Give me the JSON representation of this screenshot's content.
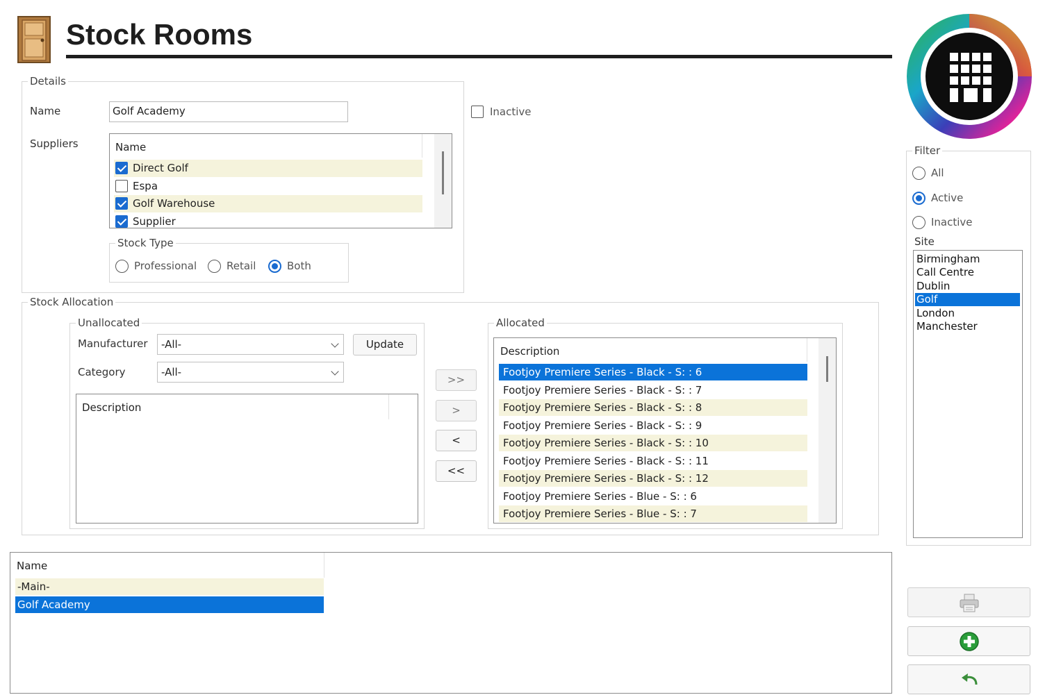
{
  "page": {
    "title": "Stock Rooms"
  },
  "details": {
    "legend": "Details",
    "name_label": "Name",
    "name_value": "Golf Academy",
    "inactive_label": "Inactive",
    "inactive_checked": false,
    "suppliers_label": "Suppliers",
    "suppliers_header": "Name",
    "suppliers": [
      {
        "name": "Direct Golf",
        "checked": true
      },
      {
        "name": "Espa",
        "checked": false
      },
      {
        "name": "Golf Warehouse",
        "checked": true
      },
      {
        "name": "Supplier",
        "checked": true
      }
    ],
    "stock_type": {
      "legend": "Stock Type",
      "options": [
        "Professional",
        "Retail",
        "Both"
      ],
      "selected": "Both"
    }
  },
  "allocation": {
    "legend": "Stock Allocation",
    "unallocated": {
      "legend": "Unallocated",
      "manufacturer_label": "Manufacturer",
      "manufacturer_value": "-All-",
      "category_label": "Category",
      "category_value": "-All-",
      "update_label": "Update",
      "list_header": "Description"
    },
    "move_buttons": [
      ">>",
      ">",
      "<",
      "<<"
    ],
    "allocated": {
      "legend": "Allocated",
      "list_header": "Description",
      "items": [
        "Footjoy Premiere Series - Black - S: : 6",
        "Footjoy Premiere Series - Black - S: : 7",
        "Footjoy Premiere Series - Black - S: : 8",
        "Footjoy Premiere Series - Black - S: : 9",
        "Footjoy Premiere Series - Black - S: : 10",
        "Footjoy Premiere Series - Black - S: : 11",
        "Footjoy Premiere Series - Black - S: : 12",
        "Footjoy Premiere Series - Blue - S: : 6",
        "Footjoy Premiere Series - Blue - S: : 7"
      ],
      "selected_index": 0
    }
  },
  "rooms": {
    "header": "Name",
    "items": [
      "-Main-",
      "Golf Academy"
    ],
    "selected_index": 1
  },
  "filter": {
    "legend": "Filter",
    "options": [
      "All",
      "Active",
      "Inactive"
    ],
    "selected": "Active",
    "site_label": "Site",
    "sites": [
      "Birmingham",
      "Call Centre",
      "Dublin",
      "Golf",
      "London",
      "Manchester"
    ],
    "selected_site": "Golf"
  },
  "actions": [
    "printer-icon",
    "add-icon",
    "undo-icon"
  ],
  "colors": {
    "selection": "#0b73d9",
    "alt_row": "#f5f3dc",
    "check_blue": "#1a6bd0"
  }
}
